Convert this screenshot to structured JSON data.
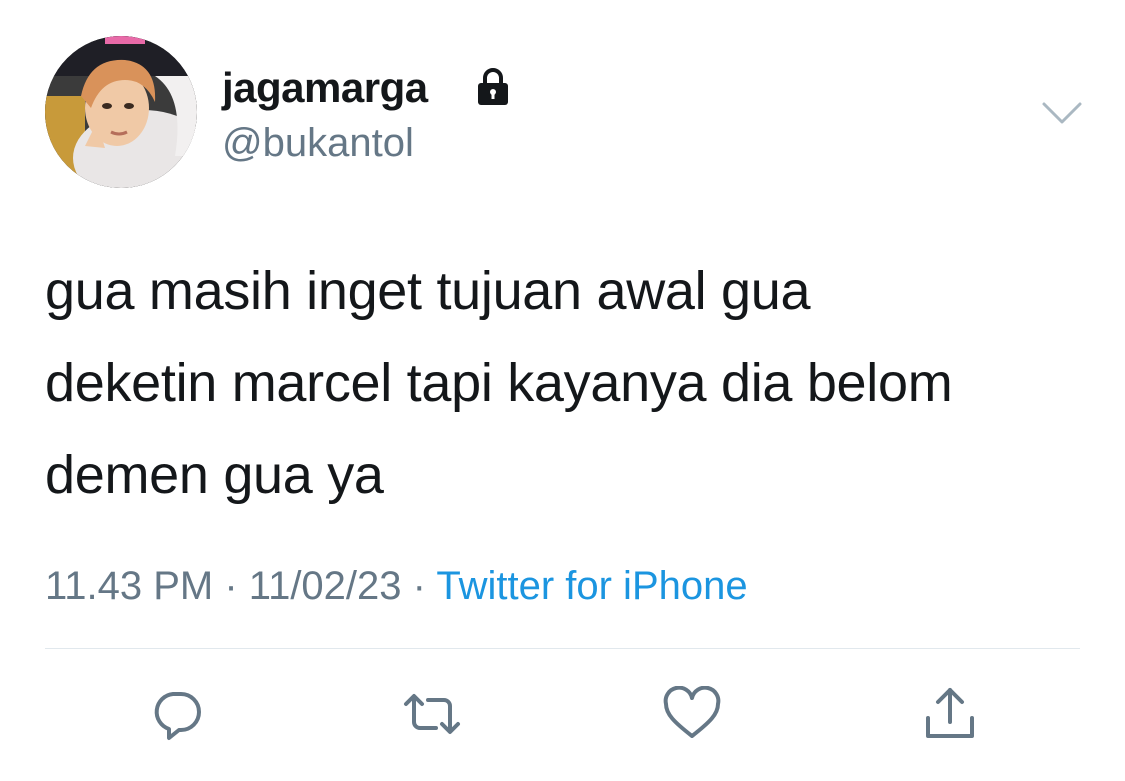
{
  "user": {
    "display_name": "jagamarga",
    "handle": "@bukantol",
    "protected_icon": "lock-icon",
    "avatar_icon": "profile-photo"
  },
  "tweet": {
    "lines": [
      "gua masih inget tujuan awal gua",
      "deketin marcel tapi kayanya dia belom",
      "demen gua ya"
    ],
    "time": "11.43 PM",
    "date": "11/02/23",
    "separator": " · ",
    "source": "Twitter for iPhone"
  },
  "menu": {
    "icon": "chevron-down-icon"
  },
  "actions": [
    {
      "name": "reply",
      "icon": "reply-icon"
    },
    {
      "name": "retweet",
      "icon": "retweet-icon"
    },
    {
      "name": "like",
      "icon": "heart-icon"
    },
    {
      "name": "share",
      "icon": "share-icon"
    }
  ],
  "colors": {
    "text": "#14171a",
    "secondary": "#657786",
    "link": "#1b95e0",
    "divider": "#e1e8ed",
    "icon": "#657786"
  }
}
